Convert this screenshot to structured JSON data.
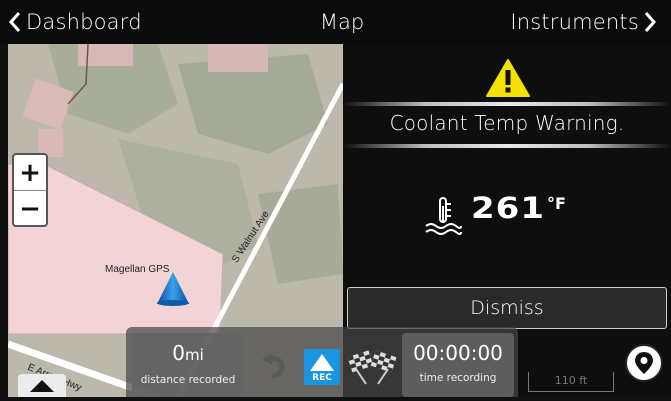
{
  "nav": {
    "back_label": "Dashboard",
    "title": "Map",
    "forward_label": "Instruments"
  },
  "map": {
    "marker_label": "Magellan GPS",
    "streets": [
      "S Walnut Ave",
      "E Arrow Hwy"
    ],
    "zoom_in": "+",
    "zoom_out": "−",
    "scale_label": "110 ft"
  },
  "warning": {
    "message": "Coolant Temp Warning.",
    "temperature_value": "261",
    "temperature_unit": "°F",
    "dismiss_label": "Dismiss",
    "accent_color": "#f4e100"
  },
  "recorder": {
    "distance_value": "0",
    "distance_unit": "mi",
    "distance_label": "distance recorded",
    "time_value": "00:00:00",
    "time_label": "time recording",
    "rec_label": "REC",
    "rec_color": "#1a95e0"
  },
  "icons": [
    "chevron-left-icon",
    "chevron-right-icon",
    "warning-triangle-icon",
    "coolant-temp-icon",
    "undo-icon",
    "checkered-flags-icon",
    "map-pin-icon",
    "chevron-up-icon"
  ]
}
